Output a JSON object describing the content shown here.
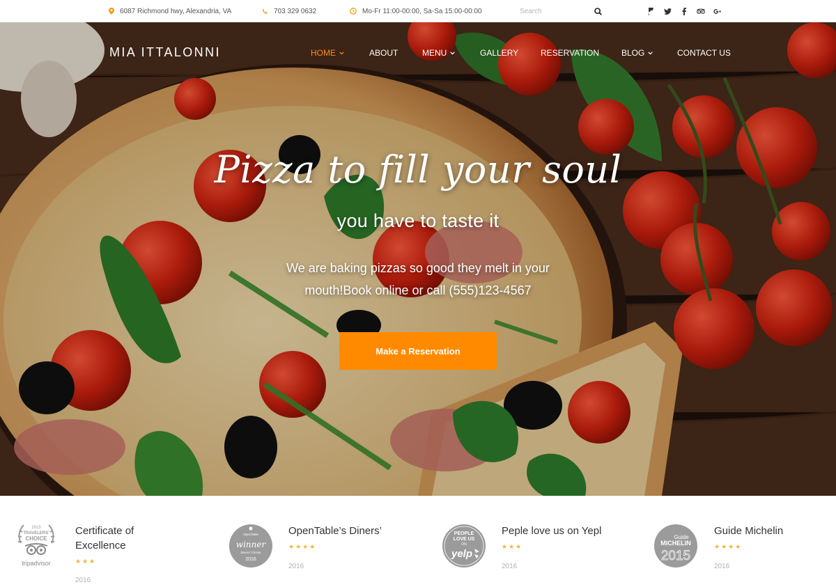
{
  "topbar": {
    "address": "6087 Richmond hwy, Alexandria, VA",
    "phone": "703 329 0632",
    "hours": "Mo-Fr 11:00-00:00, Sa-Sa 15:00-00:00",
    "search_placeholder": "Search",
    "socials": [
      "foursquare-icon",
      "twitter-icon",
      "facebook-icon",
      "tripadvisor-icon",
      "google-plus-icon"
    ],
    "icon_color": "#f39c12"
  },
  "header": {
    "logo": "MIA ITTALONNI",
    "nav": [
      {
        "label": "HOME",
        "active": true,
        "dropdown": true
      },
      {
        "label": "ABOUT",
        "active": false,
        "dropdown": false
      },
      {
        "label": "MENU",
        "active": false,
        "dropdown": true
      },
      {
        "label": "GALLERY",
        "active": false,
        "dropdown": false
      },
      {
        "label": "RESERVATION",
        "active": false,
        "dropdown": false
      },
      {
        "label": "BLOG",
        "active": false,
        "dropdown": true
      },
      {
        "label": "CONTACT US",
        "active": false,
        "dropdown": false
      }
    ],
    "active_color": "#ff8a1c"
  },
  "hero": {
    "headline": "Pizza to fill your soul",
    "subheadline": "you have to taste it",
    "description_line1": "We are baking pizzas so good they melt in your",
    "description_line2": "mouth!Book online or call (555)123-4567",
    "cta_label": "Make a Reservation",
    "cta_color": "#ff8a00"
  },
  "awards": [
    {
      "title_line1": "Certificate of",
      "title_line2": "Excellence",
      "stars": "★★★",
      "year": "2016",
      "logo": "tripadvisor-badge-icon",
      "badge_text": [
        "2015",
        "TRAVELERS'",
        "CHOICE",
        "tripadvisor"
      ]
    },
    {
      "title_line1": "OpenTable’s Diners’",
      "title_line2": "",
      "stars": "★★★★",
      "year": "2016",
      "logo": "opentable-badge-icon",
      "badge_text": [
        "OpenTable",
        "winner",
        "Diners' Choice",
        "2016"
      ]
    },
    {
      "title_line1": "Peple love us on Yepl",
      "title_line2": "",
      "stars": "★★★",
      "year": "2016",
      "logo": "yelp-badge-icon",
      "badge_text": [
        "PEOPLE",
        "LOVE US",
        "ON",
        "yelp"
      ]
    },
    {
      "title_line1": "Guide Michelin",
      "title_line2": "",
      "stars": "★★★★",
      "year": "2016",
      "logo": "michelin-badge-icon",
      "badge_text": [
        "Guide",
        "MICHELIN",
        "2015"
      ]
    }
  ],
  "star_color": "#f0b437"
}
